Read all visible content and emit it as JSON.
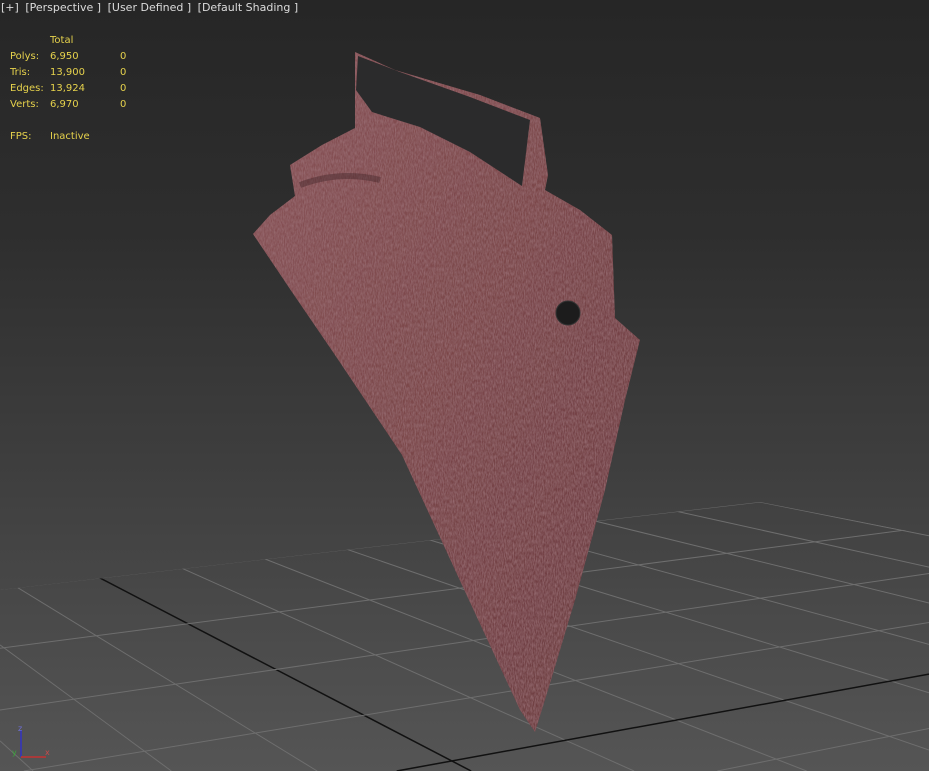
{
  "viewport": {
    "menu_plus": "[+]",
    "view": "[Perspective ]",
    "style": "[User Defined ]",
    "shading": "[Default Shading ]"
  },
  "stats": {
    "header": "Total",
    "rows": [
      {
        "label": "Polys:",
        "total": "6,950",
        "selected": "0"
      },
      {
        "label": "Tris:",
        "total": "13,900",
        "selected": "0"
      },
      {
        "label": "Edges:",
        "total": "13,924",
        "selected": "0"
      },
      {
        "label": "Verts:",
        "total": "6,970",
        "selected": "0"
      }
    ],
    "fps_label": "FPS:",
    "fps_value": "Inactive"
  },
  "axis": {
    "x": "x",
    "y": "y",
    "z": "z"
  },
  "colors": {
    "stats_text": "#e6d24c",
    "fabric": "#7a4a4e",
    "grid_line": "#6e6e6e",
    "grid_main": "#111111"
  }
}
